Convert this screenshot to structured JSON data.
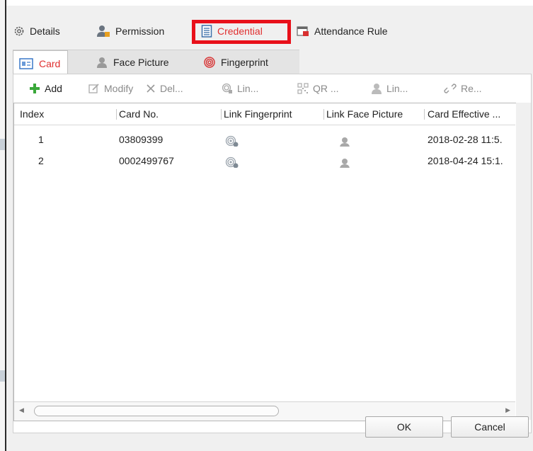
{
  "window": {
    "tabs": [
      {
        "label": "Details",
        "icon": "gear-icon"
      },
      {
        "label": "Permission",
        "icon": "user-key-icon"
      },
      {
        "label": "Credential",
        "icon": "document-icon",
        "active": true
      },
      {
        "label": "Attendance Rule",
        "icon": "calendar-icon"
      }
    ]
  },
  "credential": {
    "tabs": [
      {
        "label": "Card",
        "icon": "card-icon",
        "active": true
      },
      {
        "label": "Face Picture",
        "icon": "person-icon"
      },
      {
        "label": "Fingerprint",
        "icon": "fingerprint-icon"
      }
    ],
    "toolbar": {
      "add": "Add",
      "modify": "Modify",
      "delete": "Del...",
      "link": "Lin...",
      "qr": "QR ...",
      "link_person": "Lin...",
      "reset": "Re..."
    },
    "table": {
      "columns": [
        "Index",
        "Card No.",
        "Link Fingerprint",
        "Link Face Picture",
        "Card Effective ..."
      ],
      "rows": [
        {
          "index": "1",
          "card_no": "03809399",
          "card_effective": "2018-02-28 11:5."
        },
        {
          "index": "2",
          "card_no": "0002499767",
          "card_effective": "2018-04-24 15:1."
        }
      ]
    }
  },
  "buttons": {
    "ok": "OK",
    "cancel": "Cancel"
  },
  "colors": {
    "highlight_box": "#e8101a",
    "active_tab_text": "#e03030",
    "add_icon": "#3aa83a"
  }
}
